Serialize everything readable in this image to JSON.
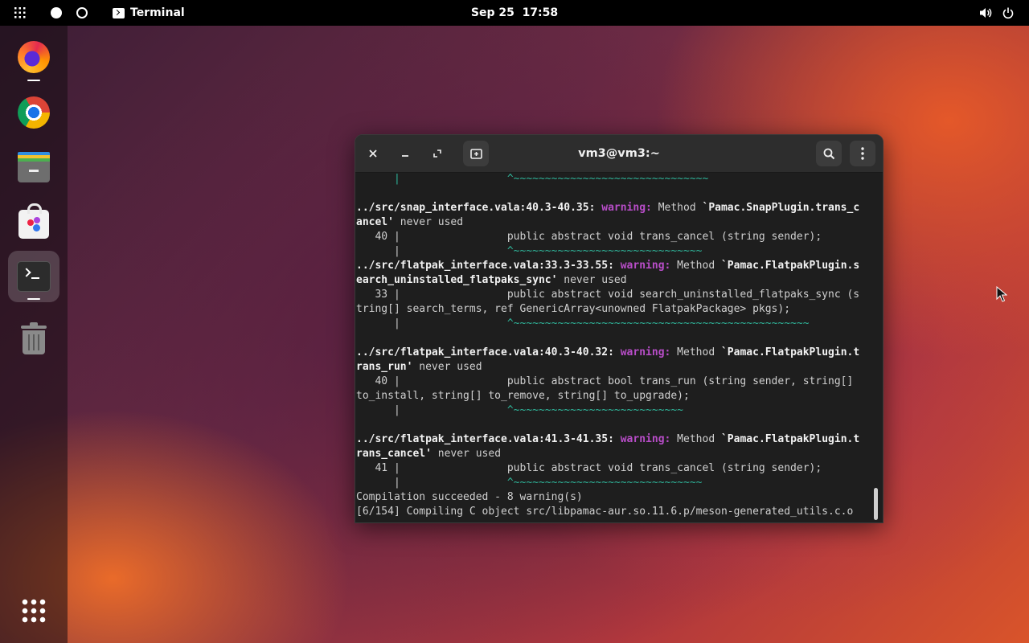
{
  "topbar": {
    "app_name": "Terminal",
    "clock": "Sep 25  17:58"
  },
  "dock": {
    "items": [
      "Firefox",
      "Google Chrome",
      "Files",
      "Software",
      "Terminal",
      "Trash",
      "Show Applications"
    ]
  },
  "window": {
    "title": "vm3@vm3:~",
    "lines": [
      [
        {
          "c": "t",
          "v": "      |                 ^~~~~~~~~~~~~~~~~~~~~~~~~~~~~~~~"
        }
      ],
      [
        {
          "c": "",
          "v": ""
        }
      ],
      [
        {
          "c": "b",
          "v": "../src/snap_interface.vala:40.3-40.35: "
        },
        {
          "c": "w",
          "v": "warning:"
        },
        {
          "c": "",
          "v": " Method "
        },
        {
          "c": "b",
          "v": "`Pamac.SnapPlugin.trans_c"
        }
      ],
      [
        {
          "c": "b",
          "v": "ancel'"
        },
        {
          "c": "",
          "v": " never used"
        }
      ],
      [
        {
          "c": "",
          "v": "   40 |                 public abstract void trans_cancel (string sender);"
        }
      ],
      [
        {
          "c": "",
          "v": "      | "
        },
        {
          "c": "t",
          "v": "                ^~~~~~~~~~~~~~~~~~~~~~~~~~~~~~~"
        }
      ],
      [
        {
          "c": "b",
          "v": "../src/flatpak_interface.vala:33.3-33.55: "
        },
        {
          "c": "w",
          "v": "warning:"
        },
        {
          "c": "",
          "v": " Method "
        },
        {
          "c": "b",
          "v": "`Pamac.FlatpakPlugin.s"
        }
      ],
      [
        {
          "c": "b",
          "v": "earch_uninstalled_flatpaks_sync'"
        },
        {
          "c": "",
          "v": " never used"
        }
      ],
      [
        {
          "c": "",
          "v": "   33 |                 public abstract void search_uninstalled_flatpaks_sync (s"
        }
      ],
      [
        {
          "c": "",
          "v": "tring[] search_terms, ref GenericArray<unowned FlatpakPackage> pkgs);"
        }
      ],
      [
        {
          "c": "",
          "v": "      | "
        },
        {
          "c": "t",
          "v": "                ^~~~~~~~~~~~~~~~~~~~~~~~~~~~~~~~~~~~~~~~~~~~~~~~"
        }
      ],
      [
        {
          "c": "",
          "v": ""
        }
      ],
      [
        {
          "c": "b",
          "v": "../src/flatpak_interface.vala:40.3-40.32: "
        },
        {
          "c": "w",
          "v": "warning:"
        },
        {
          "c": "",
          "v": " Method "
        },
        {
          "c": "b",
          "v": "`Pamac.FlatpakPlugin.t"
        }
      ],
      [
        {
          "c": "b",
          "v": "rans_run'"
        },
        {
          "c": "",
          "v": " never used"
        }
      ],
      [
        {
          "c": "",
          "v": "   40 |                 public abstract bool trans_run (string sender, string[]"
        }
      ],
      [
        {
          "c": "",
          "v": "to_install, string[] to_remove, string[] to_upgrade);"
        }
      ],
      [
        {
          "c": "",
          "v": "      | "
        },
        {
          "c": "t",
          "v": "                ^~~~~~~~~~~~~~~~~~~~~~~~~~~~"
        }
      ],
      [
        {
          "c": "",
          "v": ""
        }
      ],
      [
        {
          "c": "b",
          "v": "../src/flatpak_interface.vala:41.3-41.35: "
        },
        {
          "c": "w",
          "v": "warning:"
        },
        {
          "c": "",
          "v": " Method "
        },
        {
          "c": "b",
          "v": "`Pamac.FlatpakPlugin.t"
        }
      ],
      [
        {
          "c": "b",
          "v": "rans_cancel'"
        },
        {
          "c": "",
          "v": " never used"
        }
      ],
      [
        {
          "c": "",
          "v": "   41 |                 public abstract void trans_cancel (string sender);"
        }
      ],
      [
        {
          "c": "",
          "v": "      | "
        },
        {
          "c": "t",
          "v": "                ^~~~~~~~~~~~~~~~~~~~~~~~~~~~~~~"
        }
      ],
      [
        {
          "c": "",
          "v": "Compilation succeeded - 8 warning(s)"
        }
      ],
      [
        {
          "c": "",
          "v": "[6/154] Compiling C object src/libpamac-aur.so.11.6.p/meson-generated_utils.c.o"
        }
      ]
    ]
  },
  "colors": {
    "warning": "#b84dc8",
    "tilde": "#2fb59a",
    "terminal_bg": "#1e1e1e",
    "header_bg": "#2d2d2d"
  }
}
